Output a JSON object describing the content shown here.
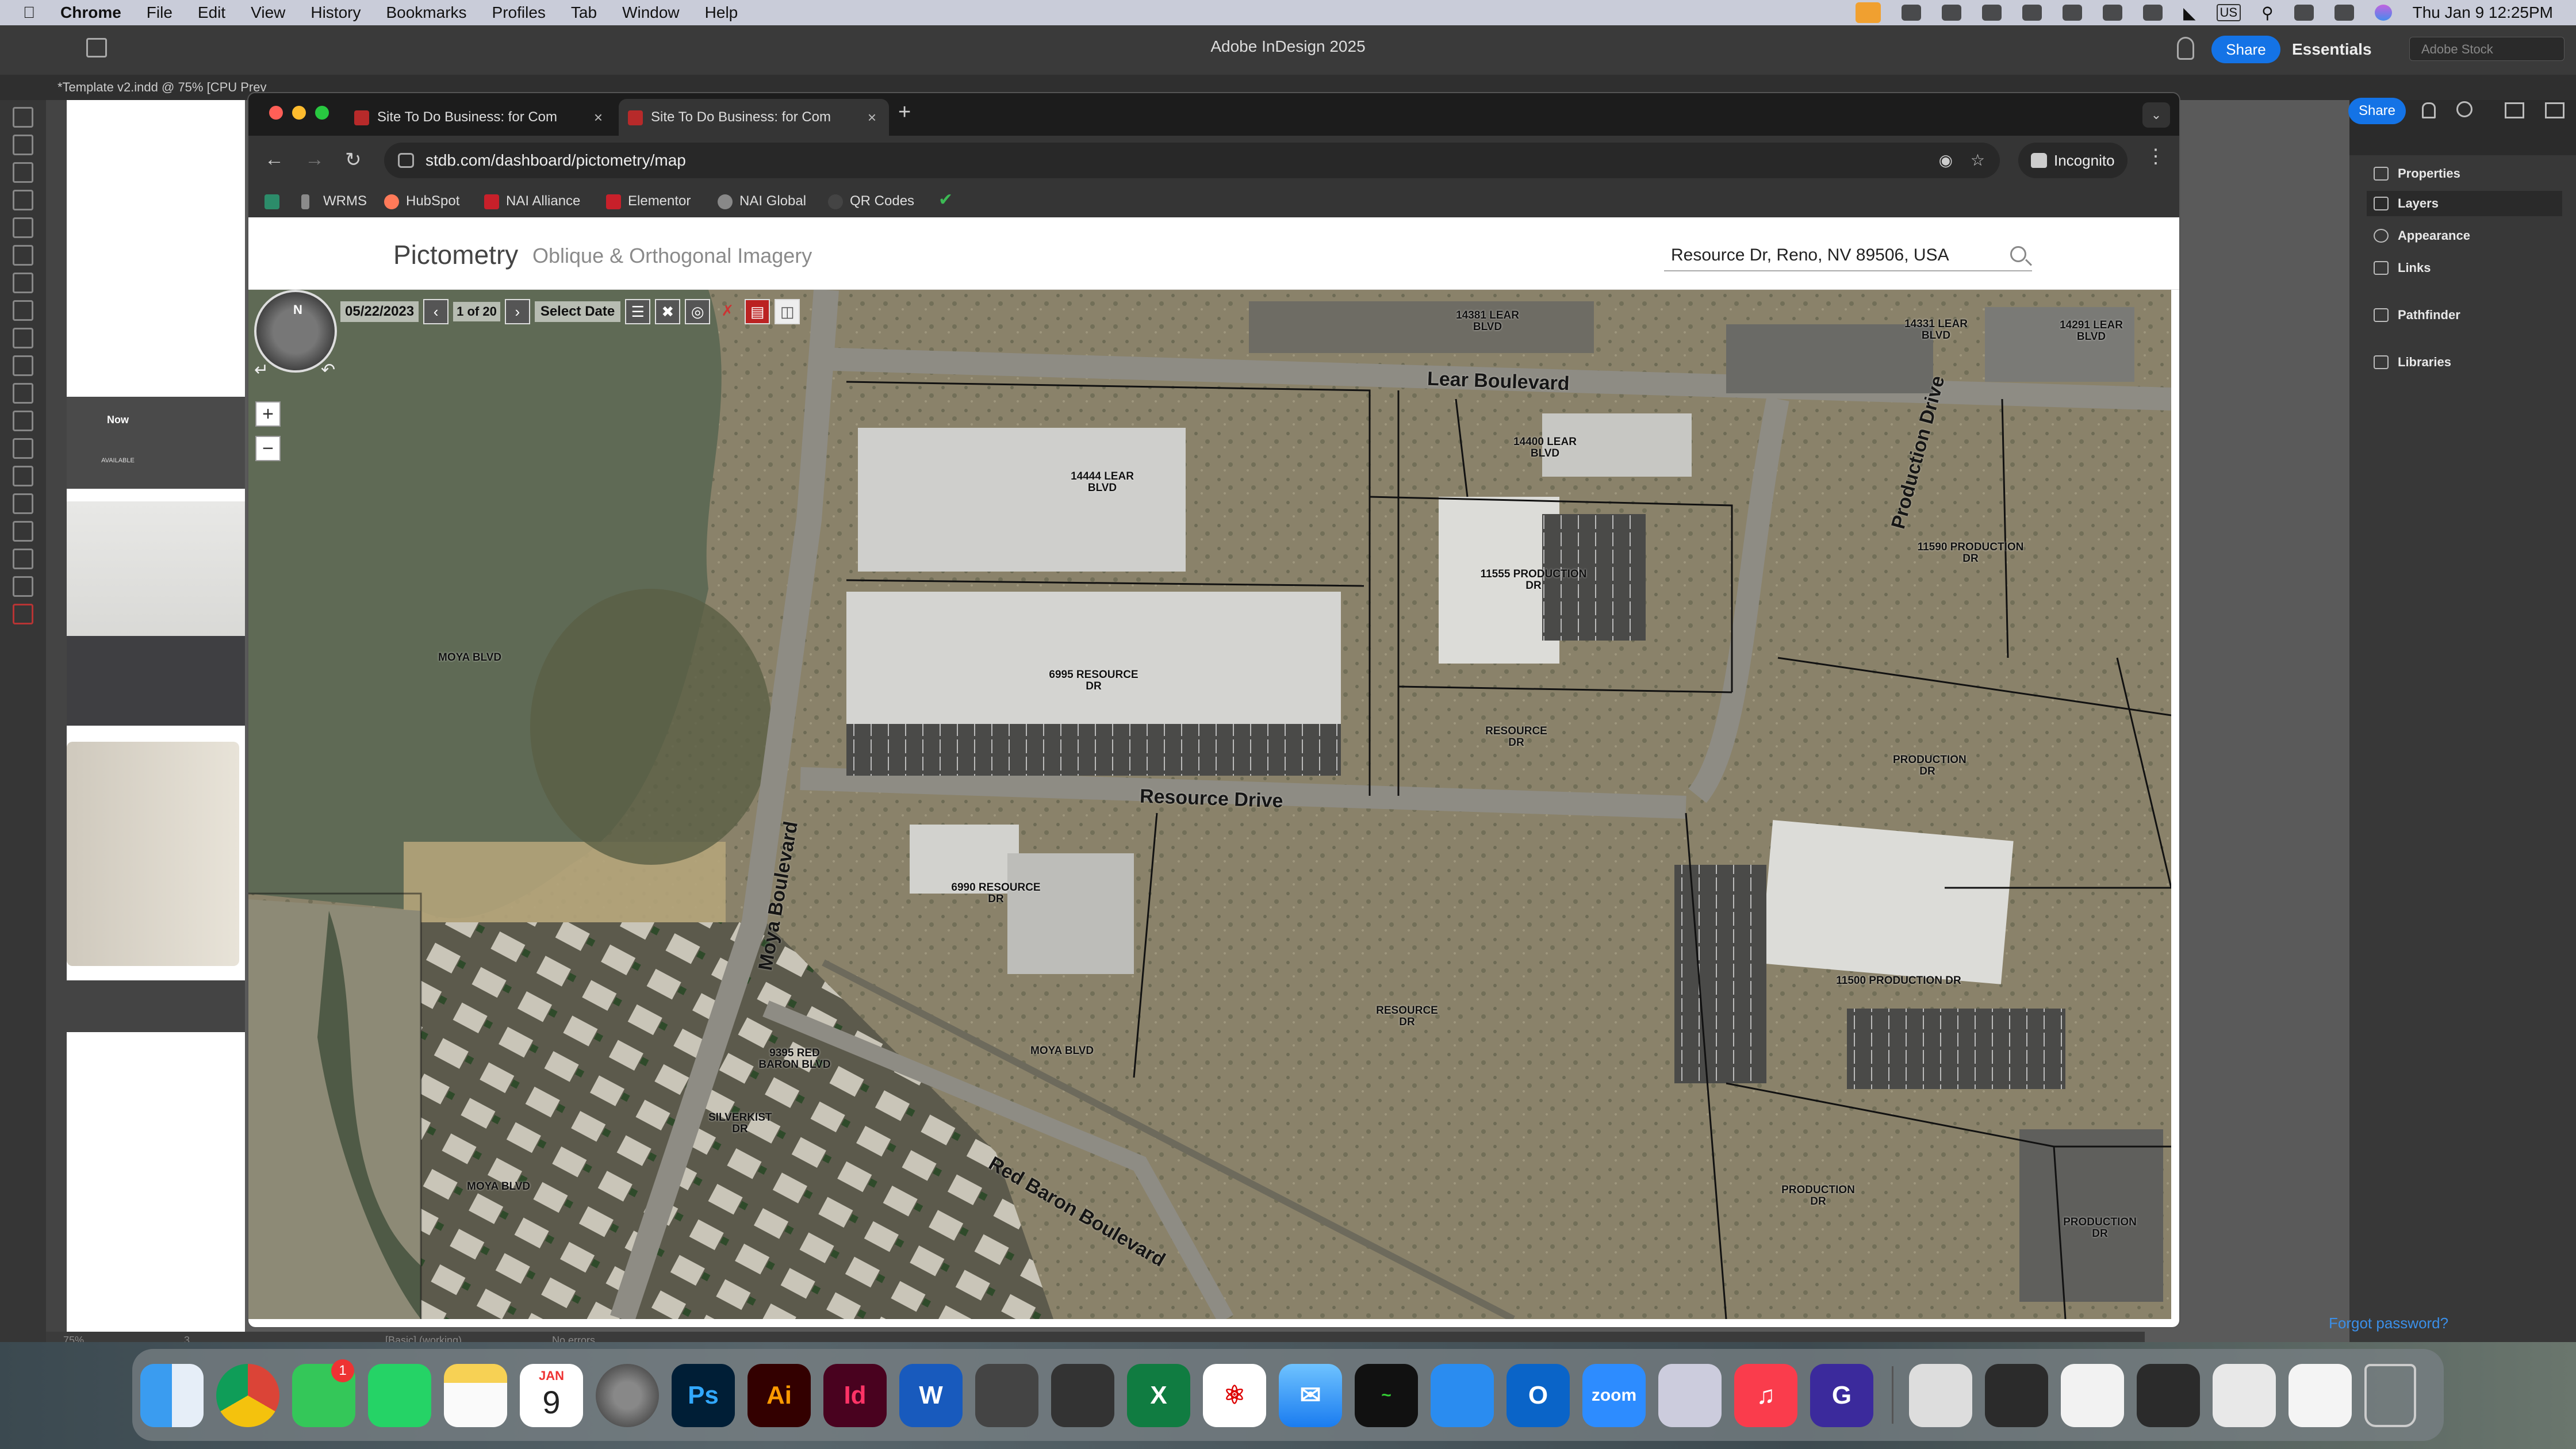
{
  "menubar": {
    "app": "Chrome",
    "items": [
      "File",
      "Edit",
      "View",
      "History",
      "Bookmarks",
      "Profiles",
      "Tab",
      "Window",
      "Help"
    ],
    "input_source": "US",
    "clock": "Thu Jan 9  12:25PM"
  },
  "indesign": {
    "title": "Adobe InDesign 2025",
    "share_label": "Share",
    "workspace": "Essentials",
    "stock_placeholder": "Adobe Stock",
    "doc_tab": "*Template v2.indd @ 75% [CPU Prev",
    "thumb_now_label": "Now",
    "thumb_now_sub": "AVAILABLE",
    "panels": [
      "Properties",
      "Layers",
      "Appearance",
      "Links",
      "Pathfinder",
      "Libraries"
    ],
    "forgot_password": "Forgot password?",
    "status": {
      "zoom": "75%",
      "page": "3",
      "style": "[Basic] (working)",
      "errors": "No errors"
    }
  },
  "chrome": {
    "tabs": [
      {
        "title": "Site To Do Business: for Com",
        "active": false
      },
      {
        "title": "Site To Do Business: for Com",
        "active": true
      }
    ],
    "url": "stdb.com/dashboard/pictometry/map",
    "incognito_label": "Incognito",
    "bookmarks": [
      "WRMS",
      "HubSpot",
      "NAI Alliance",
      "Elementor",
      "NAI Global",
      "QR Codes"
    ]
  },
  "pictometry": {
    "brand": "Pictometry",
    "subtitle": "Oblique & Orthogonal Imagery",
    "search_value": "Resource Dr, Reno, NV 89506, USA",
    "toolbar": {
      "date": "05/22/2023",
      "count": "1 of 20",
      "select_date": "Select Date"
    },
    "compass_n": "N",
    "zoom_in": "+",
    "zoom_out": "−"
  },
  "map": {
    "roads": [
      "Lear Boulevard",
      "Resource Drive",
      "Production Drive",
      "Moya Boulevard",
      "Red Baron Boulevard"
    ],
    "parcels": [
      "14381 LEAR BLVD",
      "14331 LEAR BLVD",
      "14291 LEAR BLVD",
      "14444 LEAR BLVD",
      "14400 LEAR BLVD",
      "11555 PRODUCTION DR",
      "11590 PRODUCTION DR",
      "6995 RESOURCE DR",
      "MOYA BLVD",
      "RESOURCE DR",
      "PRODUCTION DR",
      "6990 RESOURCE DR",
      "11500 PRODUCTION DR",
      "RESOURCE DR",
      "9395 RED BARON BLVD",
      "MOYA BLVD",
      "SILVERKIST DR",
      "MOYA BLVD",
      "PRODUCTION DR",
      "PRODUCTION DR"
    ]
  },
  "dock": {
    "apps": [
      "Finder",
      "Chrome",
      "Messages",
      "WhatsApp",
      "Notes",
      "Calendar",
      "System Settings",
      "Photoshop",
      "Illustrator",
      "InDesign",
      "Word",
      "Screenshot",
      "Calculator",
      "Excel",
      "Acrobat",
      "Mail",
      "Activity Monitor",
      "Docs",
      "Outlook",
      "Zoom",
      "Preview",
      "Music",
      "Grammarly"
    ],
    "messages_badge": "1",
    "calendar_month": "JAN",
    "calendar_day": "9"
  }
}
